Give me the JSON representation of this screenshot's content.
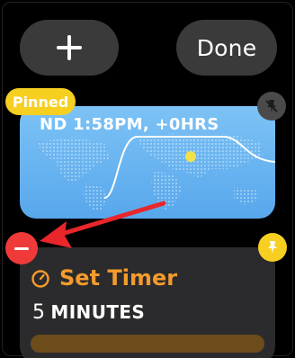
{
  "toolbar": {
    "add_icon": "plus-icon",
    "done_label": "Done"
  },
  "world_clock": {
    "badge": "Pinned",
    "time_text": "ND 1:58PM, +0HRS",
    "pin_icon": "pin-icon",
    "map_icon": "world-map-daylight"
  },
  "timer": {
    "remove_icon": "minus-icon",
    "pin_icon": "pin-icon",
    "title_icon": "timer-icon",
    "title": "Set Timer",
    "duration_value": "5",
    "duration_unit": "MINUTES",
    "progress": 1.0
  },
  "colors": {
    "badge": "#f6cf21",
    "remove": "#ef3a3a",
    "accent": "#f49b2c",
    "arrow": "#e8262b"
  }
}
